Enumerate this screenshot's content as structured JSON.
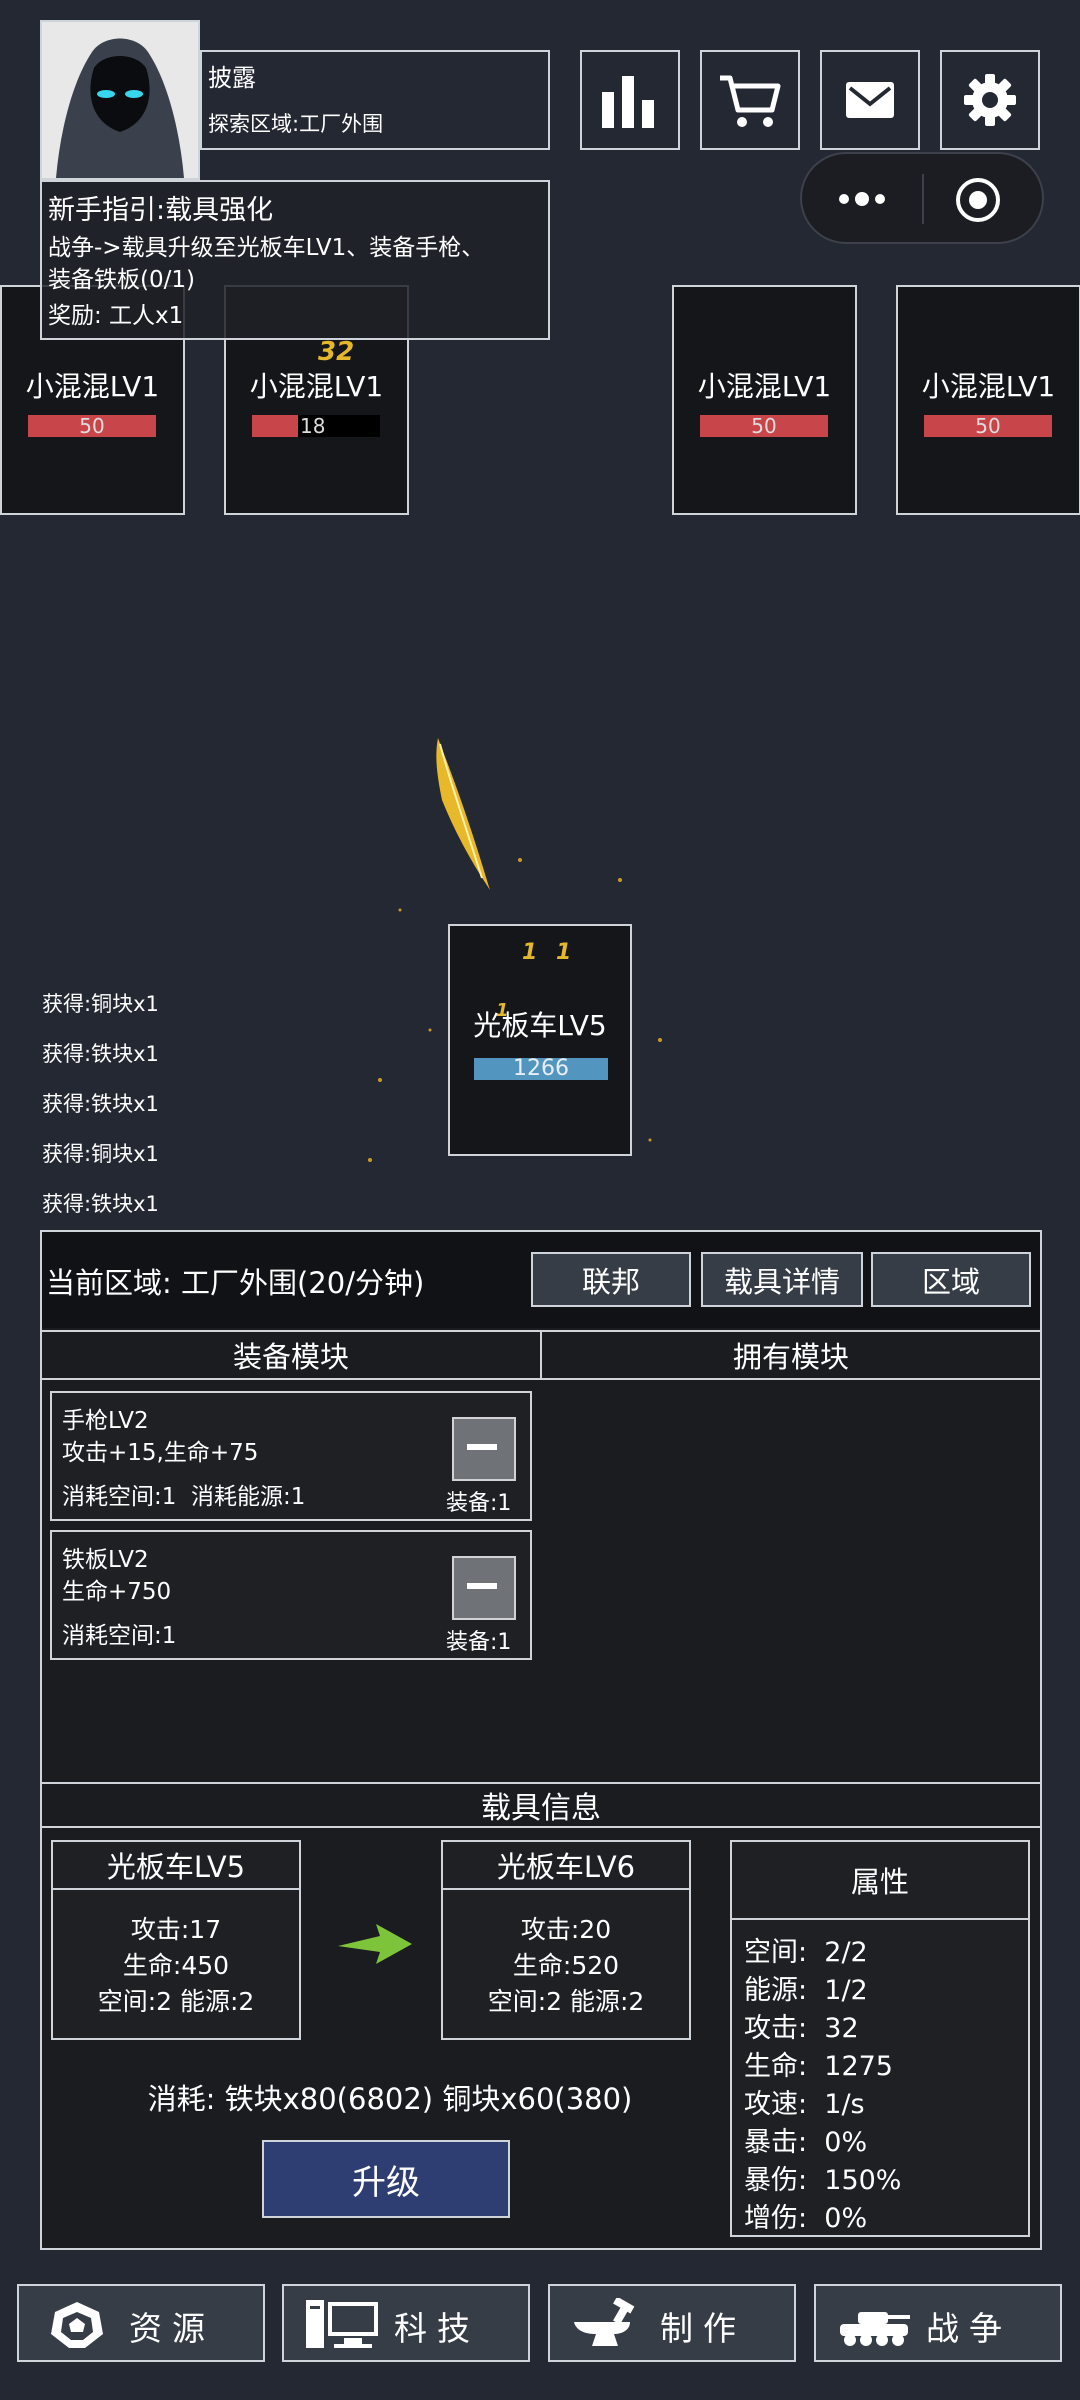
{
  "player": {
    "name": "披露",
    "explore_area": "探索区域:工厂外围"
  },
  "guide": {
    "title": "新手指引:载具强化",
    "line1": "战争->载具升级至光板车LV1、装备手枪、",
    "line2": "装备铁板(0/1)",
    "reward": "奖励: 工人x1"
  },
  "enemies": [
    {
      "name": "小混混LV1",
      "hp": "50",
      "hp_fraction": 1.0
    },
    {
      "name": "小混混LV1",
      "hp": "18",
      "hp_fraction": 0.36,
      "damage_popup": "32"
    },
    {
      "name": "小混混LV1",
      "hp": "50",
      "hp_fraction": 1.0
    },
    {
      "name": "小混混LV1",
      "hp": "50",
      "hp_fraction": 1.0
    }
  ],
  "vehicle_unit": {
    "name": "光板车LV5",
    "hp": "1266",
    "popups": [
      "1",
      "1",
      "1"
    ]
  },
  "loot_log": [
    "获得:铜块x1",
    "获得:铁块x1",
    "获得:铁块x1",
    "获得:铜块x1",
    "获得:铁块x1"
  ],
  "area": {
    "label": "当前区域: 工厂外围(20/分钟)",
    "buttons": [
      "联邦",
      "载具详情",
      "区域"
    ]
  },
  "tabs": {
    "equipped": "装备模块",
    "owned": "拥有模块"
  },
  "modules": [
    {
      "name": "手枪LV2",
      "effect": "攻击+15,生命+75",
      "cost": "消耗空间:1  消耗能源:1",
      "count": "装备:1"
    },
    {
      "name": "铁板LV2",
      "effect": "生命+750",
      "cost": "消耗空间:1",
      "count": "装备:1"
    }
  ],
  "vehicle_info": {
    "header": "载具信息",
    "current": {
      "name": "光板车LV5",
      "attack": "攻击:17",
      "hp": "生命:450",
      "space_energy": "空间:2 能源:2"
    },
    "next": {
      "name": "光板车LV6",
      "attack": "攻击:20",
      "hp": "生命:520",
      "space_energy": "空间:2 能源:2"
    },
    "cost": "消耗: 铁块x80(6802) 铜块x60(380)",
    "upgrade": "升级"
  },
  "attributes": {
    "title": "属性",
    "rows": [
      "空间:  2/2",
      "能源:  1/2",
      "攻击:  32",
      "生命:  1275",
      "攻速:  1/s",
      "暴击:  0%",
      "暴伤:  150%",
      "增伤:  0%"
    ]
  },
  "nav": [
    "资源",
    "科技",
    "制作",
    "战争"
  ],
  "colors": {
    "hp_enemy": "#c8454a",
    "hp_player": "#5295bf",
    "upgrade_btn": "#2e3e72",
    "arrow": "#7ec43a"
  }
}
